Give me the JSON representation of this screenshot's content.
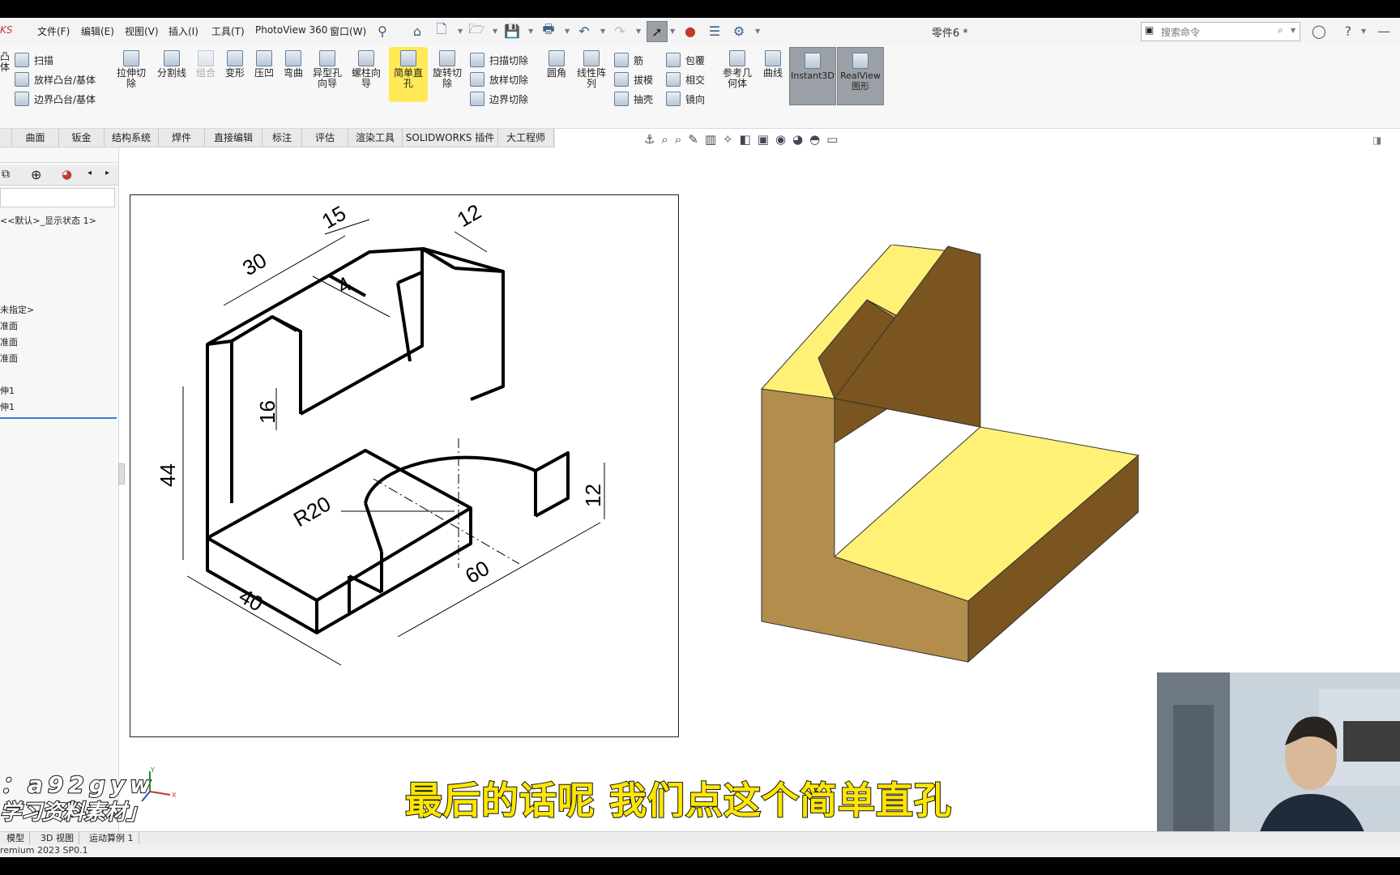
{
  "app": {
    "brand": "KS",
    "menu": [
      "文件(F)",
      "编辑(E)",
      "视图(V)",
      "插入(I)",
      "工具(T)",
      "PhotoView 360",
      "窗口(W)"
    ],
    "document_title": "零件6 *",
    "search_placeholder": "搜索命令"
  },
  "ribbon": {
    "left_small": [
      "扫描",
      "放样凸台/基体",
      "边界凸台/基体"
    ],
    "left_big_partial": "凸\n体",
    "big_buttons": [
      {
        "label": "拉伸切\n除",
        "icon": "extrude-cut-icon"
      },
      {
        "label": "分割线",
        "icon": "split-line-icon"
      },
      {
        "label": "组合",
        "icon": "combine-icon"
      },
      {
        "label": "变形",
        "icon": "deform-icon"
      },
      {
        "label": "压凹",
        "icon": "indent-icon"
      },
      {
        "label": "弯曲",
        "icon": "flex-icon"
      },
      {
        "label": "异型孔\n向导",
        "icon": "hole-wizard-icon"
      },
      {
        "label": "螺柱向\n导",
        "icon": "stud-wizard-icon"
      },
      {
        "label": "简单直\n孔",
        "icon": "simple-hole-icon"
      },
      {
        "label": "旋转切\n除",
        "icon": "revolve-cut-icon"
      }
    ],
    "mid_small_1": [
      "扫描切除",
      "放样切除",
      "边界切除"
    ],
    "mid_big": {
      "label": "圆角",
      "icon": "fillet-icon"
    },
    "mid_big2": {
      "label": "线性阵\n列",
      "icon": "linear-pattern-icon"
    },
    "mid_small_2": [
      "筋",
      "拔模",
      "抽壳"
    ],
    "mid_small_3": [
      "包覆",
      "相交",
      "镜向"
    ],
    "right_big": [
      {
        "label": "参考几\n何体",
        "icon": "reference-geometry-icon"
      },
      {
        "label": "曲线",
        "icon": "curves-icon"
      }
    ],
    "toggles": [
      {
        "label": "Instant3D"
      },
      {
        "label": "RealView\n图形"
      }
    ]
  },
  "command_tabs": [
    "",
    "曲面",
    "钣金",
    "结构系统",
    "焊件",
    "直接编辑",
    "标注",
    "评估",
    "渲染工具",
    "SOLIDWORKS 插件",
    "大工程师"
  ],
  "tree": {
    "display_state": "<<默认>_显示状态 1>",
    "items": [
      "未指定>",
      "准面",
      "准面",
      "准面",
      "伸1",
      "伸1"
    ]
  },
  "drawing": {
    "dimensions": [
      "15",
      "12",
      "30",
      "4",
      "16",
      "44",
      "R20",
      "12",
      "40",
      "60"
    ]
  },
  "subtitle": "最后的话呢 我们点这个简单直孔",
  "watermark": {
    "line1": "：a92gyw",
    "line2": "学习资料素材」"
  },
  "axis_labels": {
    "y": "Y",
    "x": "X"
  },
  "bottom_tabs": [
    "模型",
    "3D 视图",
    "运动算例 1"
  ],
  "status_text": "remium 2023 SP0.1",
  "colors": {
    "model_top": "#fff176",
    "model_front": "#b38d4c",
    "model_side": "#7a5520",
    "highlight": "#ffe84d",
    "subtitle": "#ffe600"
  }
}
